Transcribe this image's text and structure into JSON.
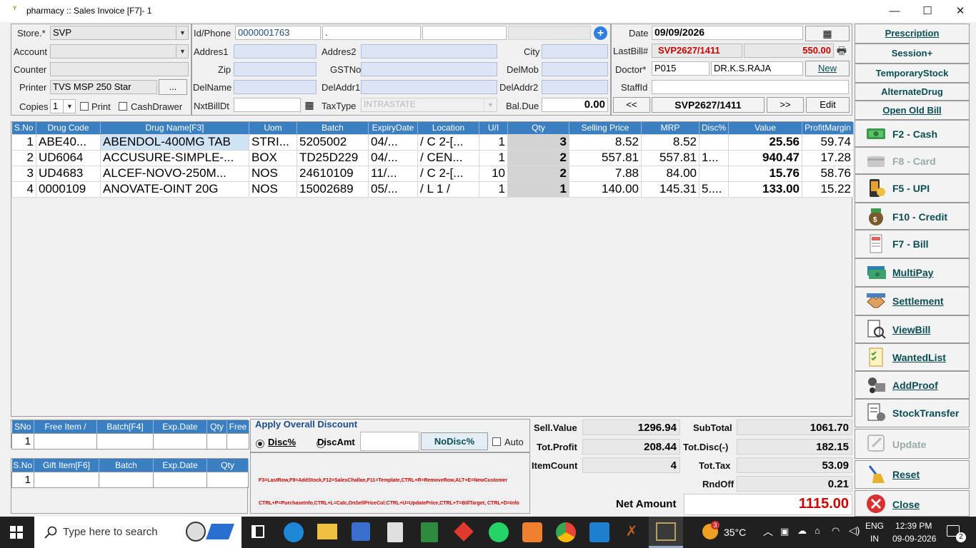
{
  "window": {
    "title": "pharmacy :: Sales Invoice [F7]- 1",
    "minimize": "—",
    "maximize": "☐",
    "close": "✕"
  },
  "header": {
    "store_label": "Store.*",
    "store_value": "SVP",
    "account_label": "Account",
    "account_value": "",
    "counter_label": "Counter",
    "counter_value": "",
    "printer_label": "Printer",
    "printer_value": "TVS MSP 250 Star",
    "printer_btn": "...",
    "copies_label": "Copies",
    "copies_value": "1",
    "print_label": "Print",
    "cashdrawer_label": "CashDrawer",
    "idphone_label": "Id/Phone",
    "idphone_value": "0000001763",
    "idphone_extra": ".",
    "addres1_label": "Addres1",
    "addres2_label": "Addres2",
    "city_label": "City",
    "zip_label": "Zip",
    "gstno_label": "GSTNo",
    "delmob_label": "DelMob",
    "delname_label": "DelName",
    "deladdr1_label": "DelAddr1",
    "deladdr2_label": "DelAddr2",
    "nxtbilldt_label": "NxtBillDt",
    "taxtype_label": "TaxType",
    "taxtype_value": "INTRASTATE",
    "baldue_label": "Bal.Due",
    "baldue_value": "0.00",
    "date_label": "Date",
    "date_value": "09/09/2026",
    "lastbill_label": "LastBill#",
    "lastbill_value": "SVP2627/1411",
    "lastbill_amount": "550.00",
    "doctor_label": "Doctor*",
    "doctor_code": "P015",
    "doctor_name": "DR.K.S.RAJA",
    "doctor_new": "New",
    "staffid_label": "StaffId",
    "staffid_value": "",
    "nav_prev": "<<",
    "nav_bill": "SVP2627/1411",
    "nav_next": ">>",
    "edit_btn": "Edit"
  },
  "grid": {
    "columns": [
      "S.No",
      "Drug Code",
      "Drug Name[F3]",
      "Uom",
      "Batch",
      "ExpiryDate",
      "Location",
      "U/I",
      "Qty",
      "Selling Price",
      "MRP",
      "Disc%",
      "Value",
      "ProfitMargin"
    ],
    "rows": [
      {
        "sno": "1",
        "code": "ABE40...",
        "name": "ABENDOL-400MG TAB",
        "uom": "STRI...",
        "batch": "5205002",
        "exp": "04/...",
        "loc": "/ C 2-[...",
        "ui": "1",
        "qty": "3",
        "sp": "8.52",
        "mrp": "8.52",
        "disc": "",
        "value": "25.56",
        "pm": "59.74"
      },
      {
        "sno": "2",
        "code": "UD6064",
        "name": "ACCUSURE-SIMPLE-...",
        "uom": "BOX",
        "batch": "TD25D229",
        "exp": "04/...",
        "loc": "/ CEN...",
        "ui": "1",
        "qty": "2",
        "sp": "557.81",
        "mrp": "557.81",
        "disc": "1...",
        "value": "940.47",
        "pm": "17.28"
      },
      {
        "sno": "3",
        "code": "UD4683",
        "name": "ALCEF-NOVO-250M...",
        "uom": "NOS",
        "batch": "24610109",
        "exp": "11/...",
        "loc": "/ C 2-[...",
        "ui": "10",
        "qty": "2",
        "sp": "7.88",
        "mrp": "84.00",
        "disc": "",
        "value": "15.76",
        "pm": "58.76"
      },
      {
        "sno": "4",
        "code": "0000109",
        "name": "ANOVATE-OINT 20G",
        "uom": "NOS",
        "batch": "15002689",
        "exp": "05/...",
        "loc": "/ L 1 /",
        "ui": "1",
        "qty": "1",
        "sp": "140.00",
        "mrp": "145.31",
        "disc": "5....",
        "value": "133.00",
        "pm": "15.22"
      }
    ]
  },
  "free_grid": {
    "columns": [
      "SNo",
      "Free Item /",
      "Batch[F4]",
      "Exp.Date",
      "Qty",
      "Free"
    ],
    "row_sno": "1"
  },
  "gift_grid": {
    "columns": [
      "S.No",
      "Gift Item[F6]",
      "Batch",
      "Exp.Date",
      "Qty"
    ],
    "row_sno": "1"
  },
  "discount": {
    "title": "Apply Overall Discount",
    "disc_pct": "Disc%",
    "disc_amt": "DiscAmt",
    "nodisc_btn": "NoDisc%",
    "auto_label": "Auto",
    "hint1": "F3=LastRow,F9=AddStock,F12=SalesChallan,F11=Template,CTRL+R=RemoveRow,ALT+E=NewCustomer",
    "hint2": "CTRL+P=PurchaseInfo,CTRL+L=Calc,OnSellPriceCol:CTRL+U=UpdatePrice,CTRL+T=BillTarget, CTRL+D=Info"
  },
  "totals": {
    "sell_value_label": "Sell.Value",
    "sell_value": "1296.94",
    "tot_profit_label": "Tot.Profit",
    "tot_profit": "208.44",
    "item_count_label": "ItemCount",
    "item_count": "4",
    "subtotal_label": "SubTotal",
    "subtotal": "1061.70",
    "tot_disc_label": "Tot.Disc(-)",
    "tot_disc": "182.15",
    "tot_tax_label": "Tot.Tax",
    "tot_tax": "53.09",
    "rndoff_label": "RndOff",
    "rndoff": "0.21",
    "net_amount_label": "Net Amount",
    "net_amount": "1115.00"
  },
  "side_buttons": {
    "prescription": "Prescription",
    "session": "Session+",
    "temporary_stock": "TemporaryStock",
    "alternate_drug": "AlternateDrug",
    "open_old_bill": "Open Old Bill",
    "cash": "F2 - Cash",
    "card": "F8 - Card",
    "upi": "F5 - UPI",
    "credit": "F10 - Credit",
    "bill": "F7 - Bill",
    "multipay": "MultiPay",
    "settlement": "Settlement",
    "viewbill": "ViewBill",
    "wantedlist": "WantedList",
    "addproof": "AddProof",
    "stocktransfer": "StockTransfer",
    "update": "Update",
    "reset": "Reset",
    "close": "Close"
  },
  "taskbar": {
    "search_placeholder": "Type here to search",
    "weather": "35°C",
    "lang1": "ENG",
    "lang2": "IN",
    "time": "12:39 PM",
    "date": "09-09-2026",
    "notif_badge": "2",
    "weather_badge": "3"
  },
  "colors": {
    "accent": "#3a7fc1",
    "button_text": "#0a4d55",
    "red": "#cc0000",
    "field_blue": "#dce4f5"
  }
}
